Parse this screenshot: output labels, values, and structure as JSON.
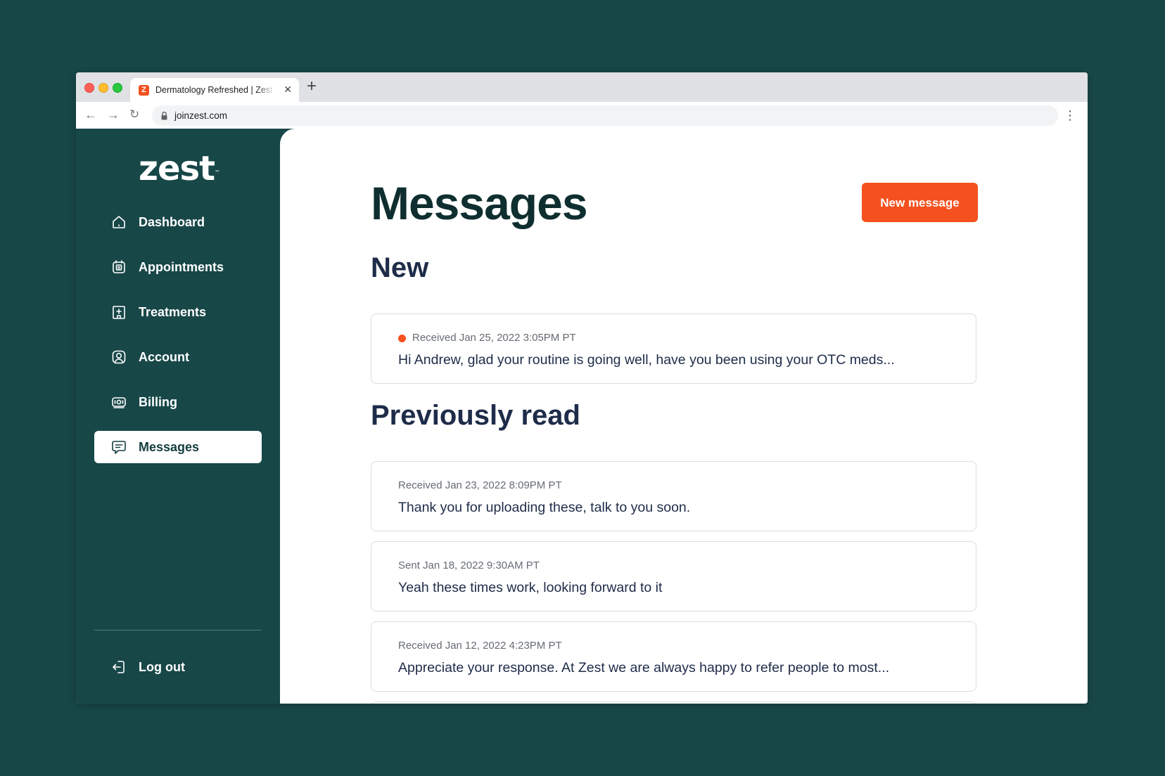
{
  "browser": {
    "tab_title": "Dermatology Refreshed | Zest",
    "tab_favicon": "Z",
    "url": "joinzest.com"
  },
  "sidebar": {
    "logo": "zest",
    "logo_tm": "™",
    "items": [
      {
        "label": "Dashboard",
        "icon": "home-icon"
      },
      {
        "label": "Appointments",
        "icon": "calendar-icon"
      },
      {
        "label": "Treatments",
        "icon": "medical-building-icon"
      },
      {
        "label": "Account",
        "icon": "user-icon"
      },
      {
        "label": "Billing",
        "icon": "cash-icon"
      },
      {
        "label": "Messages",
        "icon": "chat-icon",
        "active": true
      }
    ],
    "logout": {
      "label": "Log out",
      "icon": "logout-icon"
    }
  },
  "main": {
    "title": "Messages",
    "new_message_button": "New message",
    "new_section": {
      "title": "New",
      "messages": [
        {
          "meta": "Received Jan 25, 2022 3:05PM PT",
          "body": "Hi Andrew, glad your routine is going well, have you been using your OTC meds...",
          "unread": true
        }
      ]
    },
    "read_section": {
      "title": "Previously read",
      "messages": [
        {
          "meta": "Received Jan 23, 2022 8:09PM PT",
          "body": "Thank you for uploading these, talk to you soon."
        },
        {
          "meta": "Sent Jan 18, 2022 9:30AM PT",
          "body": "Yeah these times work, looking forward to it"
        },
        {
          "meta": "Received Jan 12, 2022 4:23PM PT",
          "body": "Appreciate your response. At Zest we are always happy to refer people to most..."
        }
      ]
    }
  },
  "colors": {
    "background": "#184748",
    "sidebar": "#184748",
    "accent": "#f4511e",
    "heading": "#0f2e2f",
    "text": "#1e2c49"
  }
}
